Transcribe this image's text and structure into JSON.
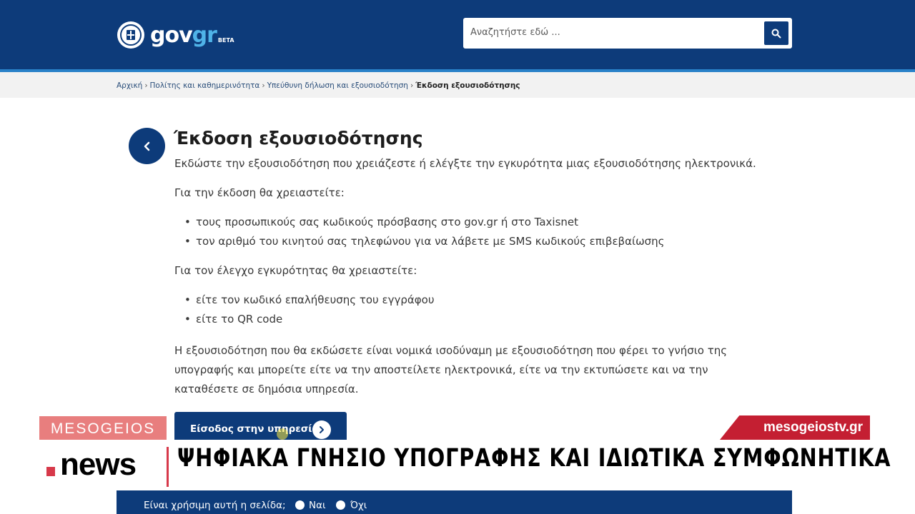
{
  "header": {
    "logo_main": "gov",
    "logo_accent": "gr",
    "logo_tag": "BETA",
    "search_placeholder": "Αναζητήστε εδώ ..."
  },
  "breadcrumb": {
    "items": [
      "Αρχική",
      "Πολίτης και καθημερινότητα",
      "Υπεύθυνη δήλωση και εξουσιοδότηση"
    ],
    "current": "Έκδοση εξουσιοδότησης"
  },
  "content": {
    "title": "Έκδοση εξουσιοδότησης",
    "intro": "Εκδώστε την εξουσιοδότηση που χρειάζεστε ή ελέγξτε την εγκυρότητα μιας εξουσιοδότησης ηλεκτρονικά.",
    "issue_heading": "Για την έκδοση θα χρειαστείτε:",
    "issue_items": [
      "τους προσωπικούς σας κωδικούς πρόσβασης στο gov.gr ή στο Taxisnet",
      "τον αριθμό του κινητού σας τηλεφώνου για να λάβετε με SMS κωδικούς επιβεβαίωσης"
    ],
    "check_heading": "Για τον έλεγχο εγκυρότητας θα χρειαστείτε:",
    "check_items": [
      "είτε τον κωδικό επαλήθευσης του εγγράφου",
      "είτε το QR code"
    ],
    "legal_text": "Η εξουσιοδότηση που θα εκδώσετε είναι νομικά ισοδύναμη με εξουσιοδότηση που φέρει το γνήσιο της υπογραφής και μπορείτε είτε να την αποστείλετε ηλεκτρονικά, είτε να την εκτυπώσετε και να την καταθέσετε σε δημόσια υπηρεσία.",
    "cta_label": "Είσοδος στην υπηρεσία"
  },
  "feedback": {
    "question": "Είναι χρήσιμη αυτή η σελίδα;",
    "yes": "Ναι",
    "no": "Όχι"
  },
  "overlay": {
    "channel": "MESOGEIOS",
    "website": "mesogeiostv.gr",
    "news_label": "news",
    "headline": "ΨΗΦΙΑΚΑ ΓΝΗΣΙΟ ΥΠΟΓΡΑΦΗΣ ΚΑΙ ΙΔΙΩΤΙΚΑ ΣΥΜΦΩΝΗΤΙΚΑ"
  },
  "colors": {
    "header_bg": "#0d3b7a",
    "accent_stripe": "#2a82c9",
    "channel_pink": "#e87e7e",
    "channel_red": "#c41f32"
  },
  "icons": [
    "greek-emblem-icon",
    "search-icon",
    "chevron-left-icon",
    "chevron-right-icon"
  ]
}
